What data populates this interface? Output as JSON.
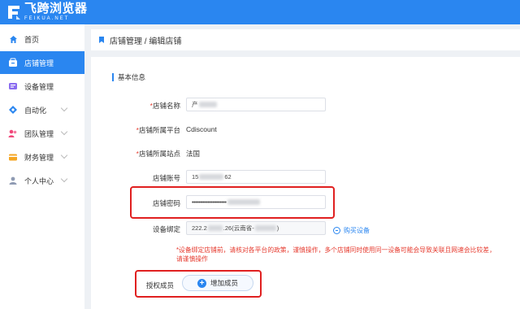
{
  "app": {
    "name": "飞跨浏览器",
    "sub": "FEIKUA.NET",
    "brand_color": "#2a86f0",
    "highlight_color": "#e02020"
  },
  "sidebar": {
    "items": [
      {
        "label": "首页",
        "icon": "home-icon",
        "active": false
      },
      {
        "label": "店铺管理",
        "icon": "store-icon",
        "active": true
      },
      {
        "label": "设备管理",
        "icon": "device-icon",
        "active": false
      },
      {
        "label": "自动化",
        "icon": "automation-icon",
        "active": false
      },
      {
        "label": "团队管理",
        "icon": "team-icon",
        "active": false
      },
      {
        "label": "财务管理",
        "icon": "finance-icon",
        "active": false
      },
      {
        "label": "个人中心",
        "icon": "user-icon",
        "active": false
      }
    ]
  },
  "header": {
    "title": "店铺管理 / 编辑店铺"
  },
  "form": {
    "section_title": "基本信息",
    "store_name": {
      "label": "店铺名称",
      "value": "产"
    },
    "platform": {
      "label": "店铺所属平台",
      "value": "Cdiscount"
    },
    "site": {
      "label": "店铺所属站点",
      "value": "法国"
    },
    "account": {
      "label": "店铺账号",
      "value_prefix": "15",
      "value_suffix": "62"
    },
    "password": {
      "label": "店铺密码",
      "value": "••••••••••••••••••••"
    },
    "device": {
      "label": "设备绑定",
      "value_prefix": "222.2",
      "value_middle": ".26(云南省-",
      "value_suffix": ")"
    },
    "buy_device": "购买设备",
    "notice": "*设备绑定店铺前，请核对各平台的政策，谨慎操作，多个店铺同时使用同一设备可能会导致关联且网速会比较差，请谨慎操作",
    "members": {
      "label": "授权成员",
      "button": "增加成员"
    },
    "required_mark": "*"
  }
}
